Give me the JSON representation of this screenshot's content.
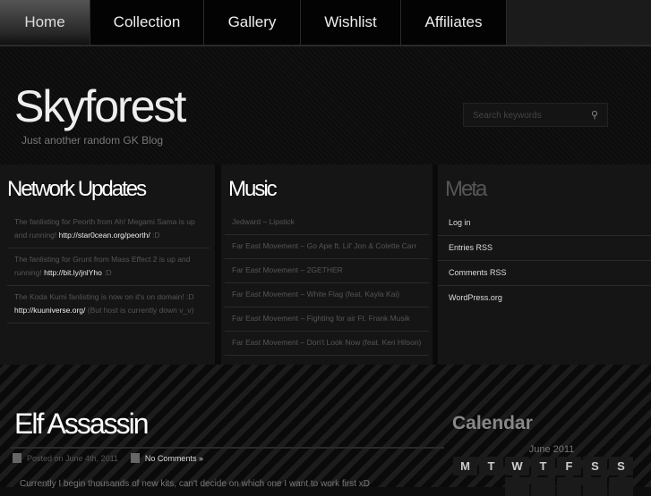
{
  "nav": {
    "items": [
      "Home",
      "Collection",
      "Gallery",
      "Wishlist",
      "Affiliates"
    ],
    "active": "Home"
  },
  "site": {
    "title": "Skyforest",
    "tagline": "Just another random GK Blog"
  },
  "search": {
    "placeholder": "Search keywords",
    "icon": "search-icon"
  },
  "network": {
    "title": "Network Updates",
    "items": [
      {
        "text": "The fanlisting for Peorth from Ah! Megami Sama is up and running!",
        "link": "http://star0cean.org/peorth/",
        "after": " :D"
      },
      {
        "text": "The fanlisting for Grunt from Mass Effect 2 is up and running!",
        "link": "http://bit.ly/jnlYho",
        "after": " :D"
      },
      {
        "text": "The Koda Kumi fanlisting is now on it's on domain! :D",
        "link": "http://kuuniverse.org/",
        "after": " (But host is currently down v_v)"
      }
    ]
  },
  "music": {
    "title": "Music",
    "items": [
      "Jedward – Lipstick",
      "Far East Movement – Go Ape ft. Lil' Jon & Colette Carr",
      "Far East Movement – 2GETHER",
      "Far East Movement – White Flag (feat. Kayla Kai)",
      "Far East Movement – Fighting for air Ft. Frank Musik",
      "Far East Movement – Don't Look Now (feat. Keri Hilson)"
    ]
  },
  "meta": {
    "title": "Meta",
    "items": [
      "Log in",
      "Entries RSS",
      "Comments RSS",
      "WordPress.org"
    ]
  },
  "post": {
    "title": "Elf Assassin",
    "posted": "Posted on June 4th, 2011",
    "comments": "No Comments »",
    "excerpt": "Currently I begin thousands of new kits, can't decide on which one I want to work first xD"
  },
  "calendar": {
    "title": "Calendar",
    "caption": "June 2011",
    "days": [
      "M",
      "T",
      "W",
      "T",
      "F",
      "S",
      "S"
    ]
  }
}
